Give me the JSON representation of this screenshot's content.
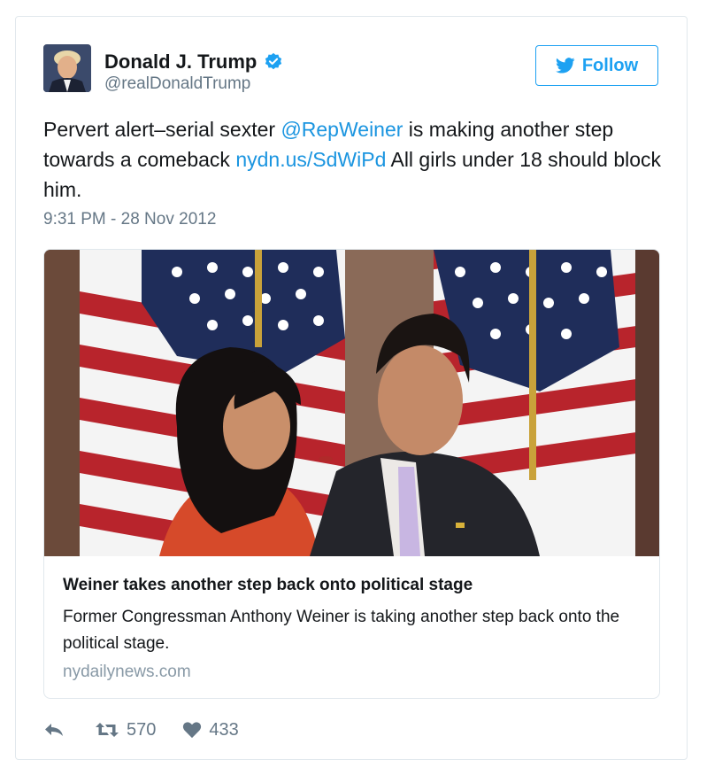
{
  "user": {
    "name": "Donald J. Trump",
    "handle": "@realDonaldTrump"
  },
  "follow_label": "Follow",
  "tweet": {
    "part1": "Pervert alert–serial sexter ",
    "mention": "@RepWeiner",
    "part2": " is making another step towards a comeback ",
    "link": "nydn.us/SdWiPd",
    "part3": " All girls under 18 should block him.",
    "timestamp": "9:31 PM - 28 Nov 2012"
  },
  "card": {
    "title": "Weiner takes another step back onto political stage",
    "description": "Former Congressman Anthony Weiner is taking another step back onto the political stage.",
    "domain": "nydailynews.com"
  },
  "stats": {
    "retweets": "570",
    "likes": "433"
  },
  "colors": {
    "link": "#1b95e0",
    "brand": "#1da1f2",
    "muted": "#657786"
  },
  "icons": [
    "verified-badge-icon",
    "twitter-bird-icon",
    "reply-icon",
    "retweet-icon",
    "heart-icon"
  ]
}
